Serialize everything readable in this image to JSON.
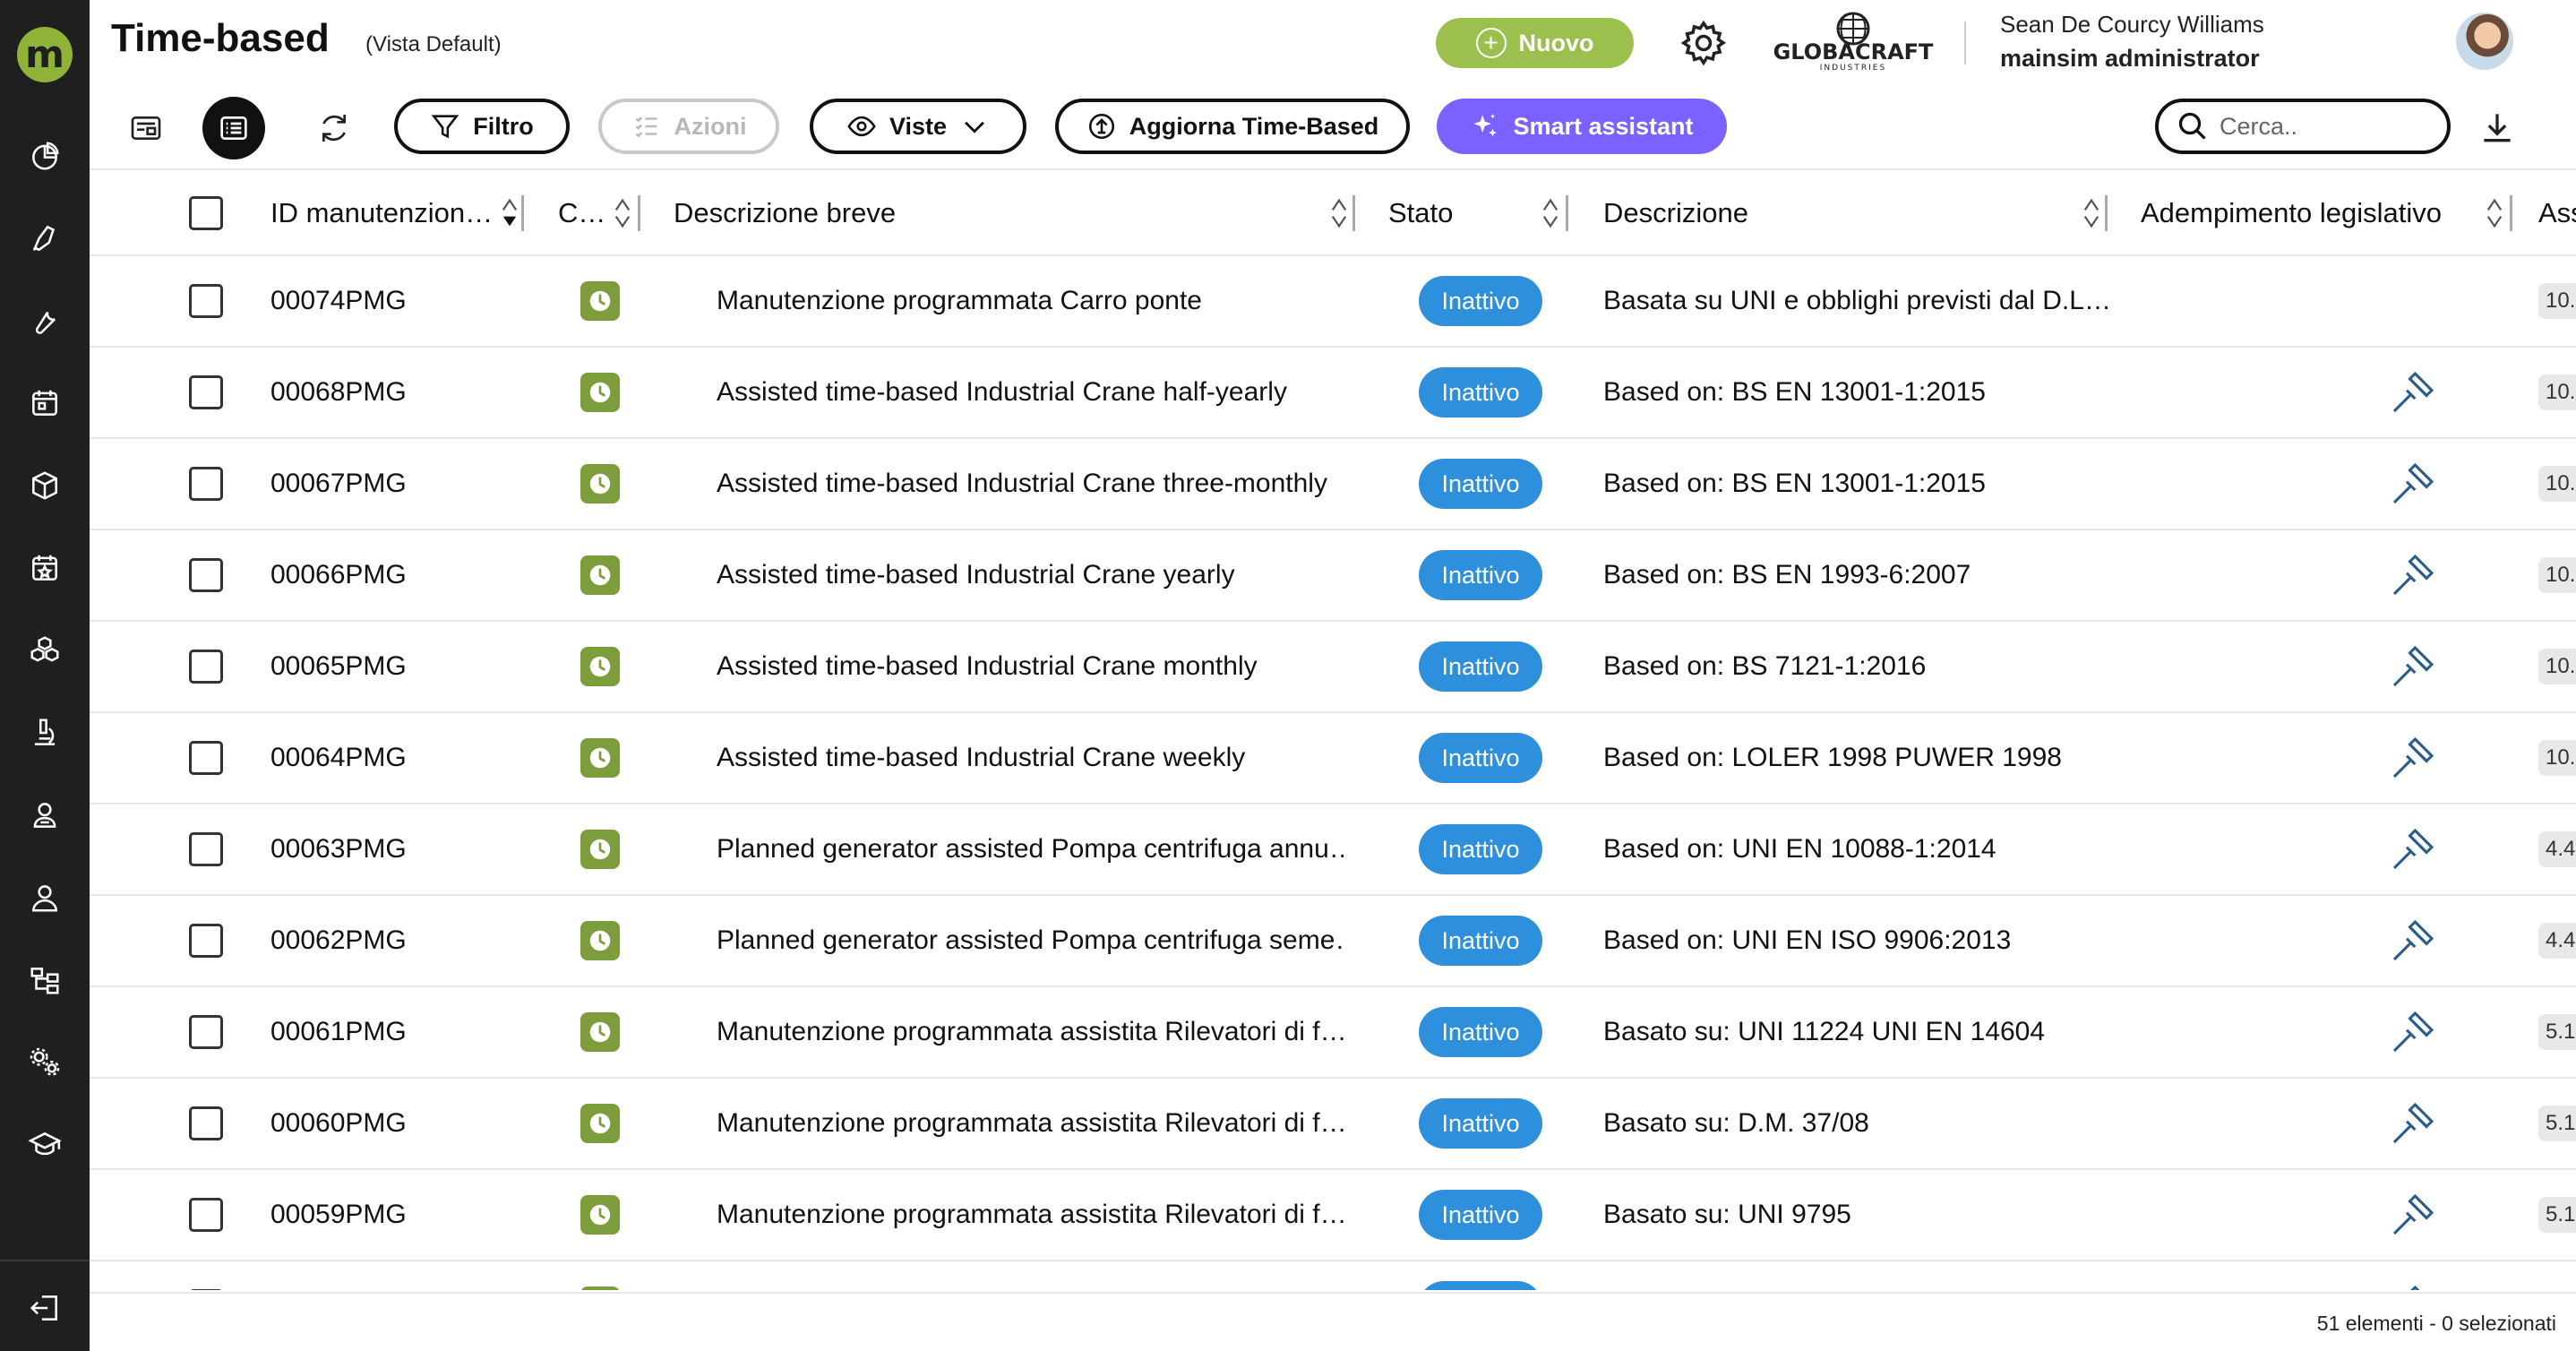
{
  "header": {
    "title": "Time-based",
    "view_label": "(Vista Default)",
    "new_label": "Nuovo",
    "brand_name": "GLOBACRAFT",
    "brand_sub": "INDUSTRIES",
    "user_name": "Sean De Courcy Williams",
    "user_role": "mainsim administrator"
  },
  "toolbar": {
    "filter_label": "Filtro",
    "actions_label": "Azioni",
    "views_label": "Viste",
    "update_label": "Aggiorna Time-Based",
    "smart_label": "Smart assistant",
    "search_placeholder": "Cerca.."
  },
  "table": {
    "columns": [
      "ID manutenzion…",
      "C…",
      "Descrizione breve",
      "Stato",
      "Descrizione",
      "Adempimento legislativo",
      "Ass"
    ],
    "rows": [
      {
        "id": "00074PMG",
        "short": "Manutenzione programmata Carro ponte",
        "status": "Inattivo",
        "desc": "Basata su UNI e obblighi previsti dal D.L…",
        "legal": false,
        "extra": "10."
      },
      {
        "id": "00068PMG",
        "short": "Assisted time-based Industrial Crane half-yearly",
        "status": "Inattivo",
        "desc": "Based on: BS EN 13001-1:2015",
        "legal": true,
        "extra": "10."
      },
      {
        "id": "00067PMG",
        "short": "Assisted time-based Industrial Crane three-monthly",
        "status": "Inattivo",
        "desc": "Based on: BS EN 13001-1:2015",
        "legal": true,
        "extra": "10."
      },
      {
        "id": "00066PMG",
        "short": "Assisted time-based Industrial Crane yearly",
        "status": "Inattivo",
        "desc": "Based on: BS EN 1993-6:2007",
        "legal": true,
        "extra": "10."
      },
      {
        "id": "00065PMG",
        "short": "Assisted time-based Industrial Crane monthly",
        "status": "Inattivo",
        "desc": "Based on: BS 7121-1:2016",
        "legal": true,
        "extra": "10."
      },
      {
        "id": "00064PMG",
        "short": "Assisted time-based Industrial Crane weekly",
        "status": "Inattivo",
        "desc": "Based on: LOLER 1998 PUWER 1998",
        "legal": true,
        "extra": "10."
      },
      {
        "id": "00063PMG",
        "short": "Planned generator assisted Pompa centrifuga annu…",
        "status": "Inattivo",
        "desc": "Based on: UNI EN 10088-1:2014",
        "legal": true,
        "extra": "4.4"
      },
      {
        "id": "00062PMG",
        "short": "Planned generator assisted Pompa centrifuga seme…",
        "status": "Inattivo",
        "desc": "Based on: UNI EN ISO 9906:2013",
        "legal": true,
        "extra": "4.4"
      },
      {
        "id": "00061PMG",
        "short": "Manutenzione programmata assistita Rilevatori di f…",
        "status": "Inattivo",
        "desc": "Basato su: UNI 11224 UNI EN 14604",
        "legal": true,
        "extra": "5.1"
      },
      {
        "id": "00060PMG",
        "short": "Manutenzione programmata assistita Rilevatori di f…",
        "status": "Inattivo",
        "desc": "Basato su: D.M. 37/08",
        "legal": true,
        "extra": "5.1"
      },
      {
        "id": "00059PMG",
        "short": "Manutenzione programmata assistita Rilevatori di f…",
        "status": "Inattivo",
        "desc": "Basato su: UNI 9795",
        "legal": true,
        "extra": "5.1"
      },
      {
        "id": "",
        "short": "",
        "status": "Inattivo",
        "desc": "",
        "legal": true,
        "extra": ""
      }
    ]
  },
  "footer": {
    "summary": "51 elementi - 0 selezionati"
  },
  "icons": {
    "sidebar": [
      "dashboard-icon",
      "rocket-icon",
      "wrench-icon",
      "calendar-icon",
      "cube-icon",
      "calendar-star-icon",
      "boxes-icon",
      "microscope-icon",
      "user-badge-icon",
      "user-icon",
      "hierarchy-icon",
      "gears-icon",
      "graduation-cap-icon",
      "logout-icon"
    ]
  },
  "colors": {
    "accent_green": "#9bc04e",
    "status_blue": "#2e8fdd",
    "smart_purple": "#7b61ff",
    "sidebar_bg": "#1f1f1f"
  }
}
